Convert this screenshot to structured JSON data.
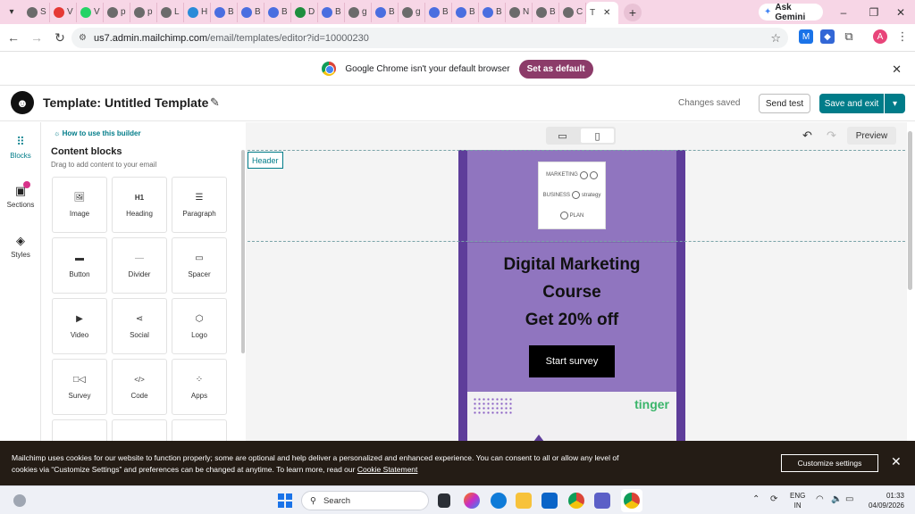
{
  "browser": {
    "tabs": [
      {
        "label": "S",
        "icon": "globe-icon",
        "color": "#6b6b6b"
      },
      {
        "label": "V",
        "icon": "youtube-icon",
        "color": "#e53935"
      },
      {
        "label": "V",
        "icon": "whatsapp-icon",
        "color": "#25d366"
      },
      {
        "label": "p",
        "icon": "globe-icon",
        "color": "#6b6b6b"
      },
      {
        "label": "p",
        "icon": "globe-icon",
        "color": "#6b6b6b"
      },
      {
        "label": "L",
        "icon": "globe-icon",
        "color": "#6b6b6b"
      },
      {
        "label": "H",
        "icon": "globe-icon",
        "color": "#2a8bd8"
      },
      {
        "label": "B",
        "icon": "blogger-icon",
        "color": "#4a6ee0"
      },
      {
        "label": "B",
        "icon": "blogger-icon",
        "color": "#4a6ee0"
      },
      {
        "label": "B",
        "icon": "blogger-icon",
        "color": "#4a6ee0"
      },
      {
        "label": "D",
        "icon": "card-icon",
        "color": "#1e8e3e"
      },
      {
        "label": "B",
        "icon": "blogger-icon",
        "color": "#4a6ee0"
      },
      {
        "label": "g",
        "icon": "globe-icon",
        "color": "#6b6b6b"
      },
      {
        "label": "B",
        "icon": "blogger-icon",
        "color": "#4a6ee0"
      },
      {
        "label": "g",
        "icon": "globe-icon",
        "color": "#6b6b6b"
      },
      {
        "label": "B",
        "icon": "blogger-icon",
        "color": "#4a6ee0"
      },
      {
        "label": "B",
        "icon": "blogger-icon",
        "color": "#4a6ee0"
      },
      {
        "label": "B",
        "icon": "blogger-icon",
        "color": "#4a6ee0"
      },
      {
        "label": "N",
        "icon": "globe-icon",
        "color": "#6b6b6b"
      },
      {
        "label": "B",
        "icon": "globe-icon",
        "color": "#6b6b6b"
      },
      {
        "label": "C",
        "icon": "globe-icon",
        "color": "#6b6b6b"
      }
    ],
    "active_tab_label": "T",
    "ask_gemini": "Ask Gemini",
    "url_host": "us7.admin.mailchimp.com",
    "url_path": "/email/templates/editor?id=10000230",
    "profile_initial": "A",
    "infobar_text": "Google Chrome isn't your default browser",
    "set_default_label": "Set as default"
  },
  "app": {
    "template_title": "Template: Untitled Template",
    "status": "Changes saved",
    "send_test": "Send test",
    "save_exit": "Save and exit",
    "accent": "#007c89"
  },
  "rail": {
    "items": [
      {
        "label": "Blocks",
        "icon": "blocks-grid-icon"
      },
      {
        "label": "Sections",
        "icon": "sections-icon"
      },
      {
        "label": "Styles",
        "icon": "paint-bucket-icon"
      }
    ]
  },
  "panel": {
    "howto": "How to use this builder",
    "title": "Content blocks",
    "subtitle": "Drag to add content to your email",
    "blocks": [
      {
        "label": "Image",
        "icon": "image-icon"
      },
      {
        "label": "Heading",
        "icon": "heading-icon"
      },
      {
        "label": "Paragraph",
        "icon": "paragraph-icon"
      },
      {
        "label": "Button",
        "icon": "button-icon"
      },
      {
        "label": "Divider",
        "icon": "divider-icon"
      },
      {
        "label": "Spacer",
        "icon": "spacer-icon"
      },
      {
        "label": "Video",
        "icon": "video-icon"
      },
      {
        "label": "Social",
        "icon": "share-icon"
      },
      {
        "label": "Logo",
        "icon": "logo-icon"
      },
      {
        "label": "Survey",
        "icon": "survey-icon"
      },
      {
        "label": "Code",
        "icon": "code-icon"
      },
      {
        "label": "Apps",
        "icon": "apps-icon"
      }
    ]
  },
  "canvas": {
    "preview": "Preview",
    "header_label": "Header",
    "email": {
      "logo_words": [
        "MARKETING",
        "BUSINESS",
        "strategy",
        "PLAN"
      ],
      "headline_1": "Digital Marketing",
      "headline_2": "Course",
      "headline_3": "Get 20% off",
      "cta": "Start survey",
      "brand": "tinger",
      "bg_color": "#9075bf",
      "border_color": "#5e3d9a"
    }
  },
  "cookie": {
    "text": "Mailchimp uses cookies for our website to function properly; some are optional and help deliver a personalized and enhanced experience. You can consent to all or allow any level of cookies via “Customize Settings” and preferences can be changed at anytime. To learn more, read our",
    "link": "Cookie Statement",
    "customize": "Customize settings"
  },
  "taskbar": {
    "search": "Search",
    "lang_1": "ENG",
    "lang_2": "IN",
    "time": "01:33",
    "date": "04/09/2026"
  }
}
